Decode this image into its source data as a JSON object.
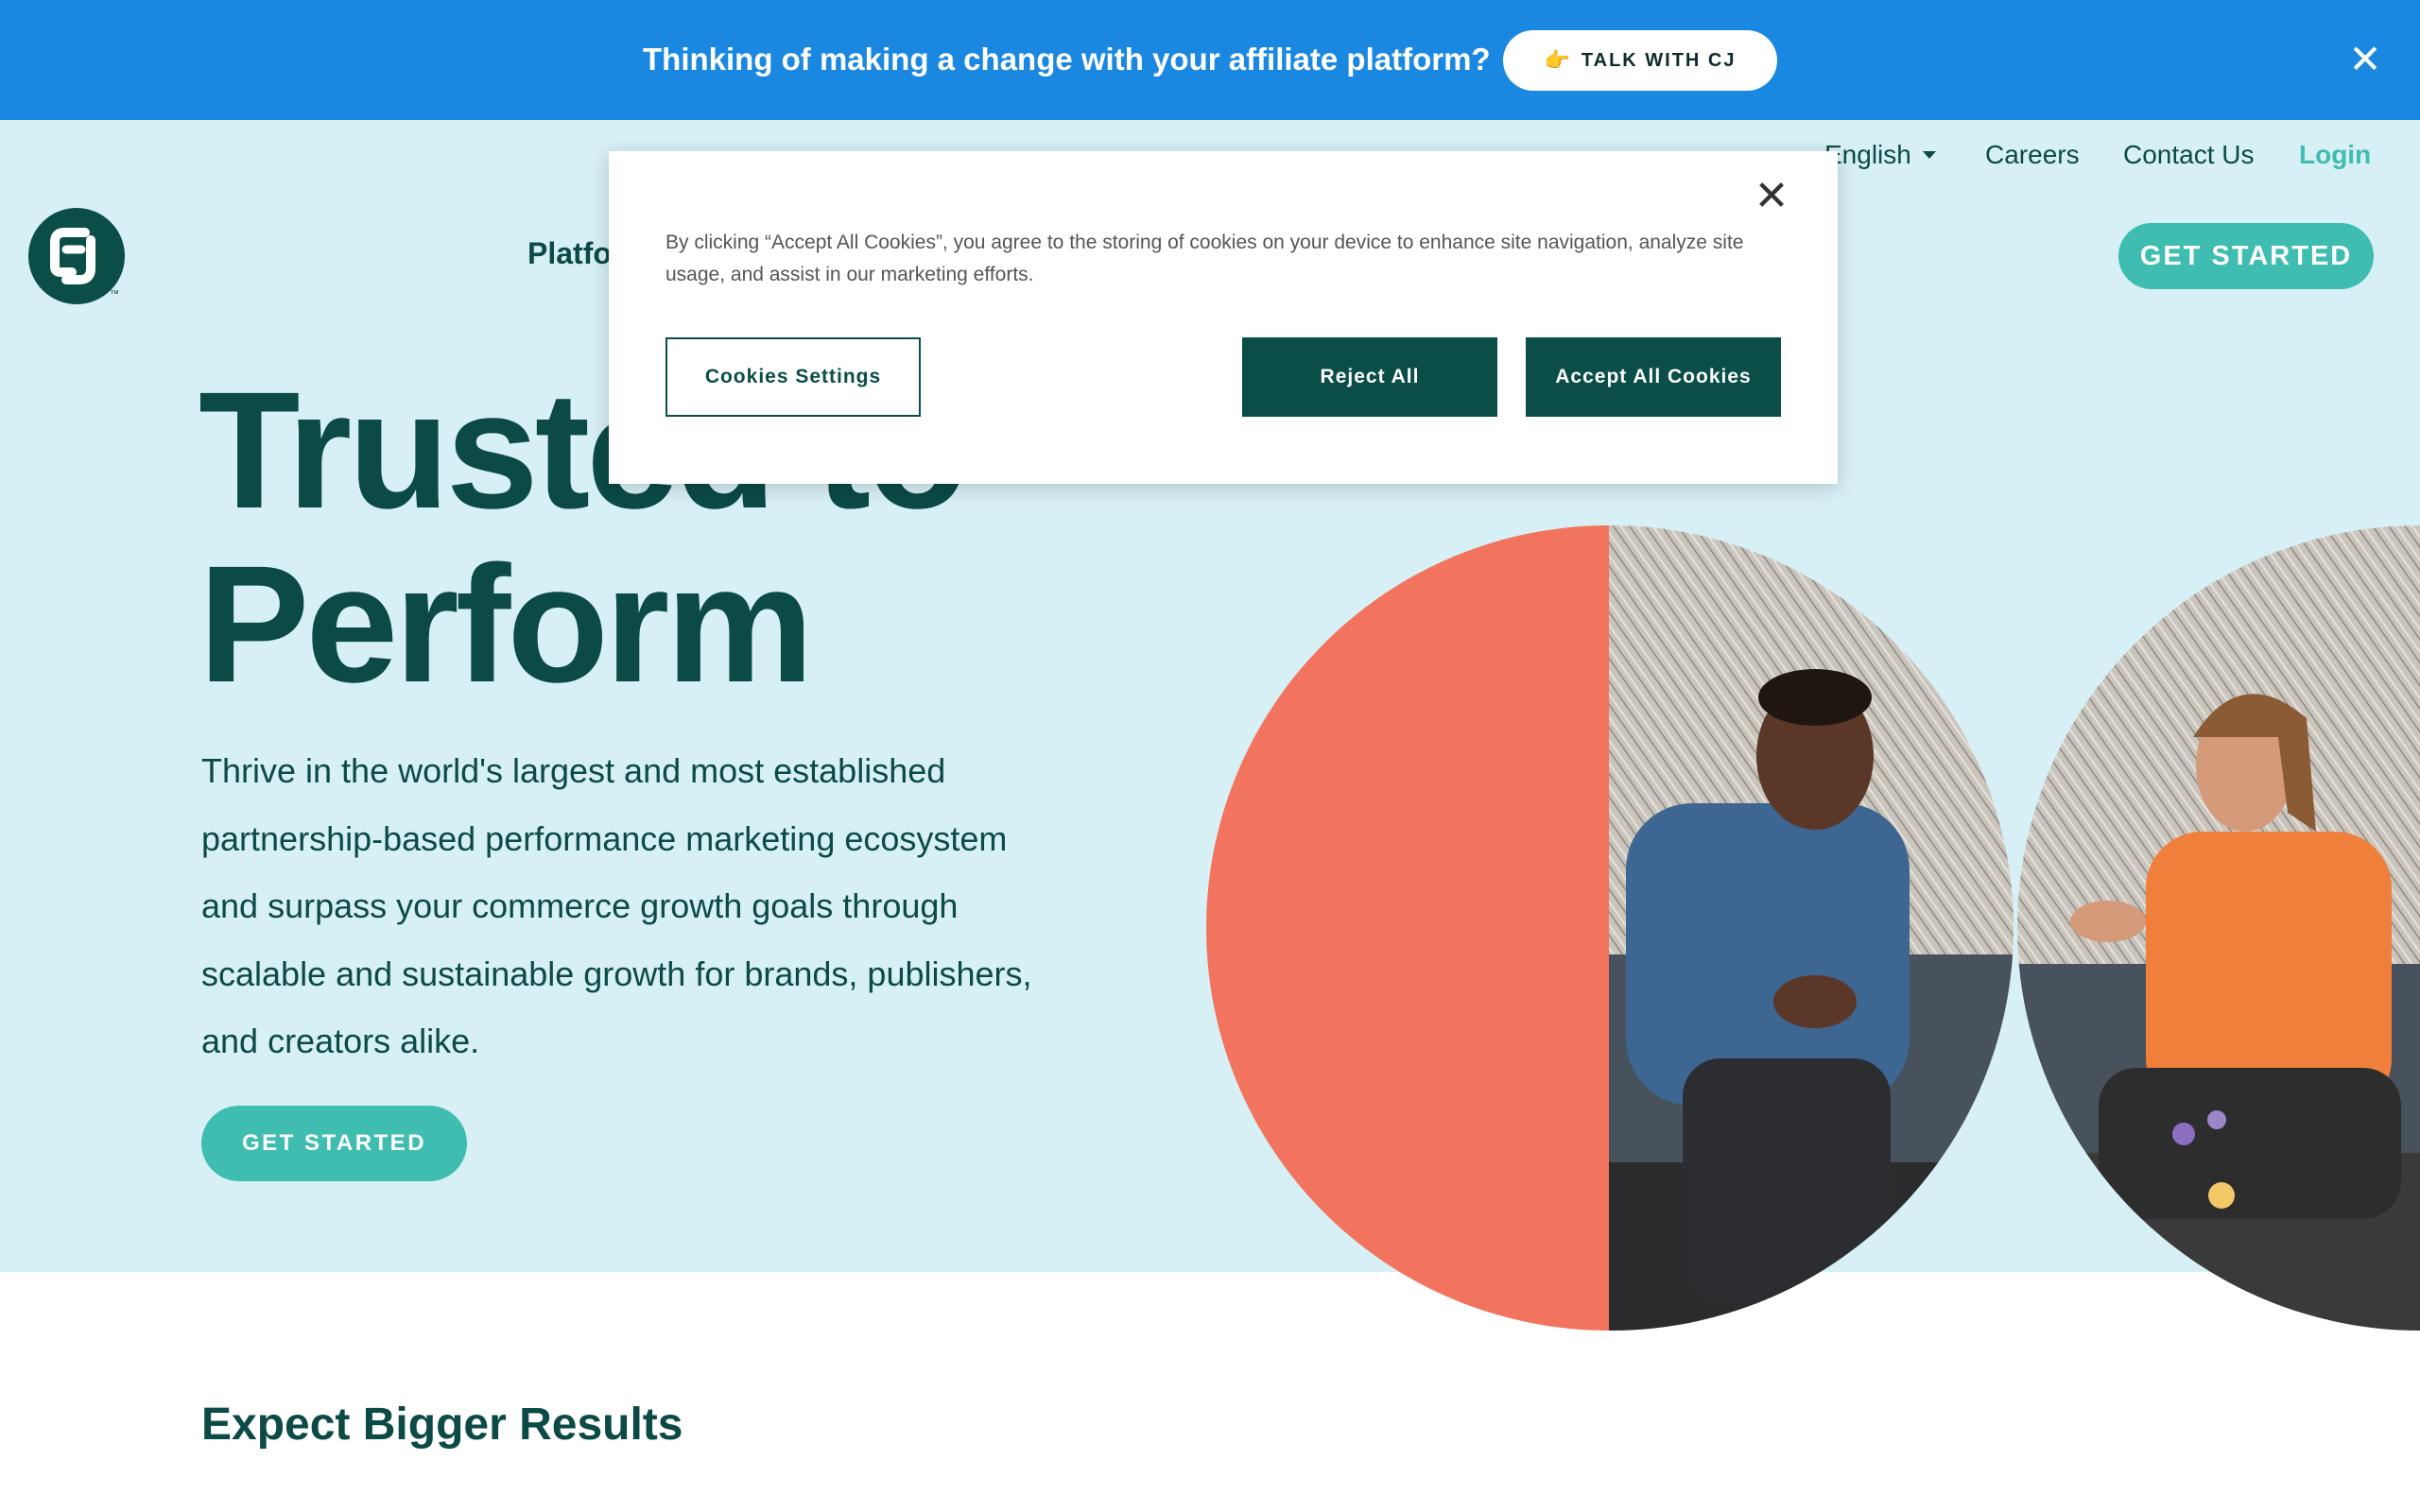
{
  "promo": {
    "text": "Thinking of making a change with your affiliate platform?",
    "button_icon": "👉",
    "button_label": "TALK WITH CJ",
    "close_icon": "close-icon"
  },
  "utility_nav": {
    "language": "English",
    "careers": "Careers",
    "contact": "Contact Us",
    "login": "Login"
  },
  "main_nav": {
    "first_item": "Platfo",
    "get_started": "GET STARTED"
  },
  "hero": {
    "headline_line1": "Trusted to",
    "headline_line2": "Perform",
    "subcopy": "Thrive in the world's largest and most established partnership-based performance marketing ecosystem and surpass your commerce growth goals through scalable and sustainable growth for brands, publishers, and creators alike.",
    "cta": "GET STARTED"
  },
  "section": {
    "title": "Expect Bigger Results"
  },
  "cookie_modal": {
    "text": "By clicking “Accept All Cookies”, you agree to the storing of cookies on your device to enhance site navigation, analyze site usage, and assist in our marketing efforts.",
    "settings": "Cookies Settings",
    "reject": "Reject All",
    "accept": "Accept All Cookies"
  },
  "colors": {
    "banner": "#1a88e0",
    "hero_bg": "#d7f0f5",
    "brand_dark": "#0a4e47",
    "accent_teal": "#3fbdb0",
    "coral": "#f2745e"
  }
}
